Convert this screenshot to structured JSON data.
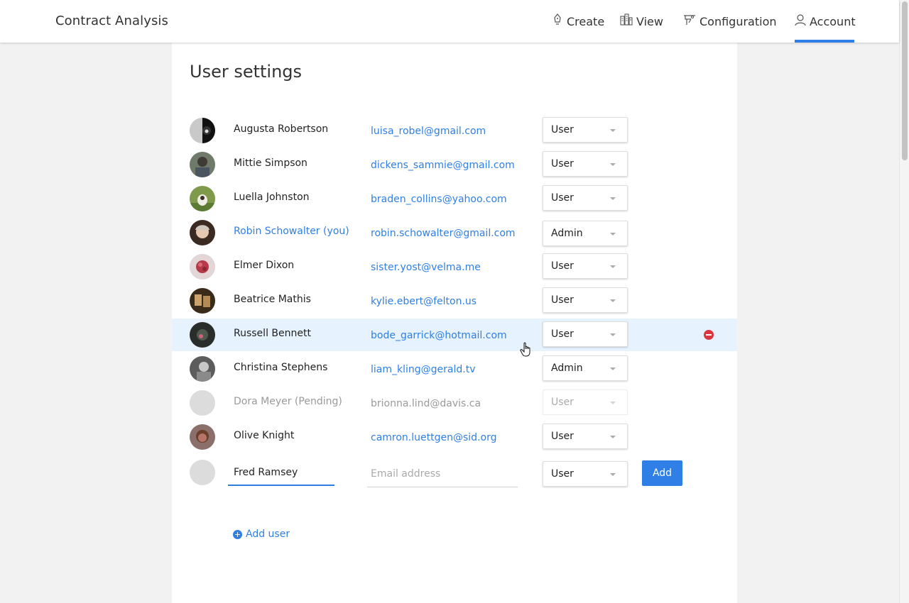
{
  "app_title": "Contract Analysis",
  "nav": {
    "create": "Create",
    "view": "View",
    "configuration": "Configuration",
    "account": "Account",
    "active": "account"
  },
  "page": {
    "title": "User settings"
  },
  "colors": {
    "accent": "#2f7fe6",
    "danger": "#d9363e",
    "row_highlight": "#e6f2fd"
  },
  "users": [
    {
      "name": "Augusta Robertson",
      "email": "luisa_robel@gmail.com",
      "role": "User"
    },
    {
      "name": "Mittie Simpson",
      "email": "dickens_sammie@gmail.com",
      "role": "User"
    },
    {
      "name": "Luella Johnston",
      "email": "braden_collins@yahoo.com",
      "role": "User"
    },
    {
      "name": "Robin Schowalter (you)",
      "email": "robin.schowalter@gmail.com",
      "role": "Admin"
    },
    {
      "name": "Elmer Dixon",
      "email": "sister.yost@velma.me",
      "role": "User"
    },
    {
      "name": "Beatrice Mathis",
      "email": "kylie.ebert@felton.us",
      "role": "User"
    },
    {
      "name": "Russell Bennett",
      "email": "bode_garrick@hotmail.com",
      "role": "User"
    },
    {
      "name": "Christina Stephens",
      "email": "liam_kling@gerald.tv",
      "role": "Admin"
    },
    {
      "name": "Dora Meyer (Pending)",
      "email": "brionna.lind@davis.ca",
      "role": "User"
    },
    {
      "name": "Olive Knight",
      "email": "camron.luettgen@sid.org",
      "role": "User"
    }
  ],
  "new_user": {
    "name_value": "Fred Ramsey",
    "email_placeholder": "Email address",
    "role": "User",
    "add_label": "Add"
  },
  "add_user_label": "Add user"
}
